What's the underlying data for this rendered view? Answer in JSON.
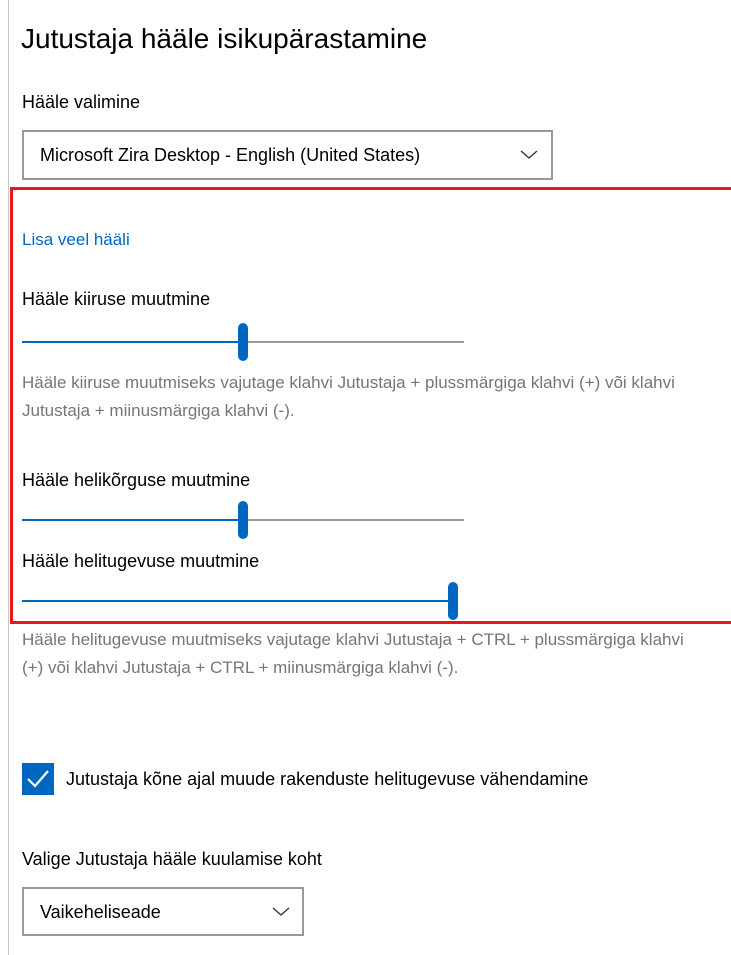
{
  "page": {
    "title": "Jutustaja hääle isikupärastamine"
  },
  "voice_select": {
    "label": "Hääle valimine",
    "value": "Microsoft Zira Desktop - English (United States)",
    "chevron_icon": "chevron-down-icon"
  },
  "add_voices_link": "Lisa veel hääli",
  "speed": {
    "label": "Hääle kiiruse muutmine",
    "value_fraction": 0.5,
    "help": "Hääle kiiruse muutmiseks vajutage klahvi Jutustaja + plussmärgiga klahvi (+) või klahvi Jutustaja + miinusmärgiga klahvi (-)."
  },
  "pitch": {
    "label": "Hääle helikõrguse muutmine",
    "value_fraction": 0.5
  },
  "volume": {
    "label": "Hääle helitugevuse muutmine",
    "value_fraction": 1.0,
    "help": "Hääle helitugevuse muutmiseks vajutage klahvi Jutustaja + CTRL + plussmärgiga klahvi (+) või klahvi Jutustaja + CTRL + miinusmärgiga klahvi (-)."
  },
  "lower_volume_checkbox": {
    "label": "Jutustaja kõne ajal muude rakenduste helitugevuse vähendamine",
    "checked": true
  },
  "output_select": {
    "label": "Valige Jutustaja hääle kuulamise koht",
    "value": "Vaikeheliseade",
    "chevron_icon": "chevron-down-icon"
  },
  "colors": {
    "accent": "#0067c0",
    "highlight_border": "#e81818",
    "help_text": "#767676"
  }
}
